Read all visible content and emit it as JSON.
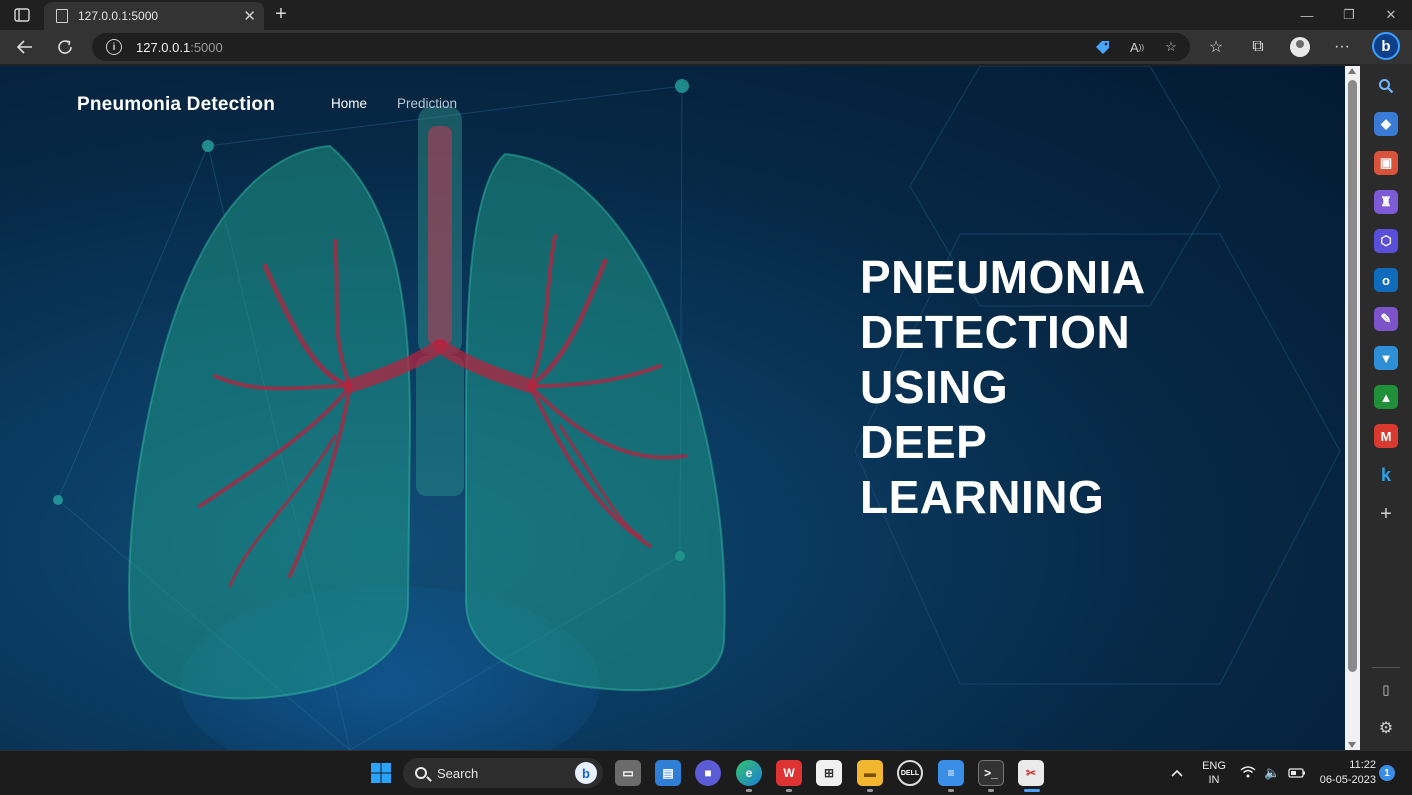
{
  "browser": {
    "tab": {
      "title": "127.0.0.1:5000"
    },
    "address": {
      "host": "127.0.0.1",
      "port": ":5000"
    }
  },
  "page": {
    "brand": "Pneumonia Detection",
    "nav": {
      "home": "Home",
      "prediction": "Prediction"
    },
    "hero": [
      "PNEUMONIA",
      "DETECTION",
      "USING",
      "DEEP",
      "LEARNING"
    ]
  },
  "taskbar": {
    "search_label": "Search",
    "lang_line1": "ENG",
    "lang_line2": "IN",
    "time": "11:22",
    "date": "06-05-2023",
    "notification_count": "1"
  }
}
